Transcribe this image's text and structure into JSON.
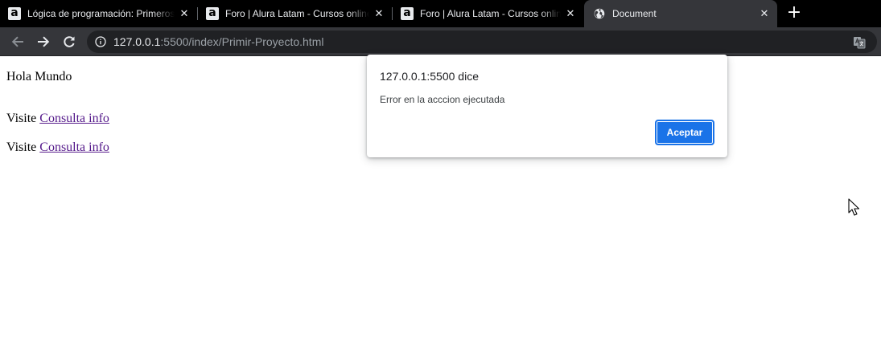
{
  "browser": {
    "tabs": [
      {
        "favicon": "alura-icon",
        "title": "Lógica de programación: Primeros pasos",
        "active": false
      },
      {
        "favicon": "alura-icon",
        "title": "Foro | Alura Latam - Cursos online de tecnología",
        "active": false
      },
      {
        "favicon": "alura-icon",
        "title": "Foro | Alura Latam - Cursos online de tecnología",
        "active": false
      },
      {
        "favicon": "globe-icon",
        "title": "Document",
        "active": true
      }
    ],
    "new_tab_label": "+",
    "address": {
      "host": "127.0.0.1",
      "rest": ":5500/index/Primir-Proyecto.html"
    },
    "colors": {
      "tabstrip": "#000000",
      "toolbar": "#35363a",
      "omnibox": "#202124"
    }
  },
  "page": {
    "heading": "Hola Mundo",
    "lines": [
      {
        "prefix": "Visite",
        "link": "Consulta info"
      },
      {
        "prefix": "Visite",
        "link": "Consulta info"
      }
    ]
  },
  "dialog": {
    "title": "127.0.0.1:5500 dice",
    "message": "Error en la acccion ejecutada",
    "ok_label": "Aceptar",
    "accent": "#1a73e8"
  }
}
